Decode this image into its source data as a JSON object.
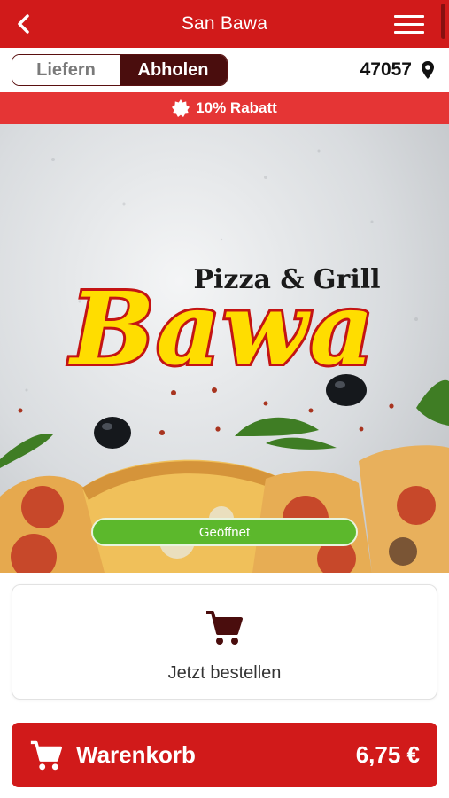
{
  "header": {
    "title": "San Bawa",
    "back_icon": "chevron-left-icon",
    "menu_icon": "hamburger-menu-icon"
  },
  "mode": {
    "options": [
      "Liefern",
      "Abholen"
    ],
    "selected": "Abholen",
    "zip": "47057",
    "zip_icon": "location-pin-icon"
  },
  "discount": {
    "label": "10% Rabatt",
    "icon": "badge-icon"
  },
  "hero": {
    "logo_subtitle": "Pizza & Grill",
    "logo_title": "Bawa",
    "status": "Geöffnet",
    "status_color": "#5cb82c"
  },
  "order": {
    "label": "Jetzt bestellen",
    "icon": "shopping-cart-icon"
  },
  "cart": {
    "label": "Warenkorb",
    "total": "6,75 €",
    "icon": "shopping-cart-icon"
  },
  "colors": {
    "brand": "#d11a1a",
    "toggle_active": "#4a0d0d",
    "discount_bar": "#e53535"
  }
}
